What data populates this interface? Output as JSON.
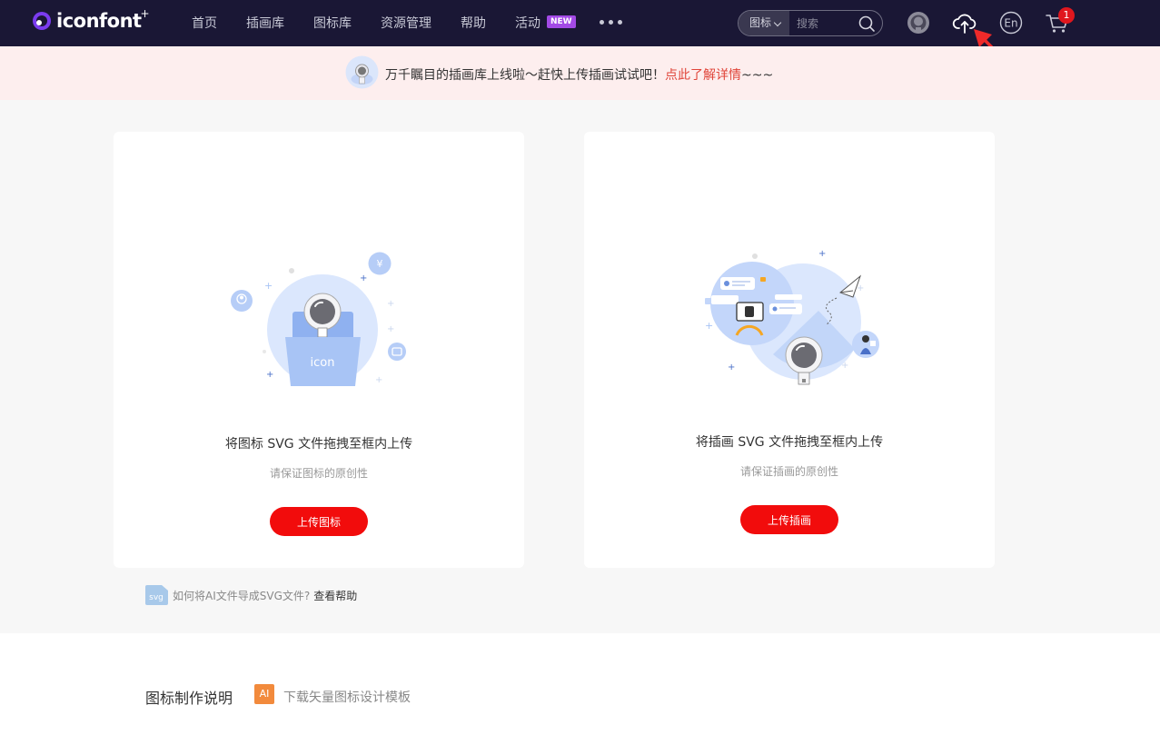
{
  "logo": {
    "text": "iconfont",
    "sup": "+"
  },
  "nav": {
    "items": [
      {
        "label": "首页"
      },
      {
        "label": "插画库"
      },
      {
        "label": "图标库"
      },
      {
        "label": "资源管理"
      },
      {
        "label": "帮助"
      },
      {
        "label": "活动"
      }
    ],
    "new_badge": "NEW",
    "search": {
      "type": "图标",
      "placeholder": "搜索"
    },
    "cart_count": "1"
  },
  "notice": {
    "text": "万千瞩目的插画库上线啦～赶快上传插画试试吧！",
    "link": "点此了解详情",
    "suffix": "~~~"
  },
  "cards": [
    {
      "illus_label": "icon",
      "title": "将图标 SVG 文件拖拽至框内上传",
      "subtitle": "请保证图标的原创性",
      "button": "上传图标"
    },
    {
      "title": "将插画 SVG 文件拖拽至框内上传",
      "subtitle": "请保证插画的原创性",
      "button": "上传插画"
    }
  ],
  "help": {
    "badge": "svg",
    "text": "如何将AI文件导成SVG文件?",
    "link": "查看帮助"
  },
  "bottom": {
    "title": "图标制作说明",
    "ai_badge": "AI",
    "link": "下载矢量图标设计模板"
  },
  "colors": {
    "nav_bg": "#1a1735",
    "notice_bg": "#fdeeee",
    "accent_red": "#f20c0c",
    "link_red": "#e0453a",
    "new_badge": "#a34ae6",
    "illus_blue": "#a8c4f5"
  }
}
